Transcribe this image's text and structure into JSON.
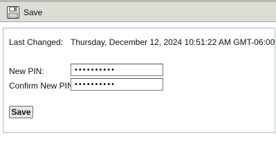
{
  "toolbar": {
    "save_label": "Save",
    "save_icon": "floppy-disk-icon"
  },
  "form": {
    "last_changed_label": "Last Changed:",
    "last_changed_value": "Thursday, December 12, 2024 10:51:22 AM GMT-06:00",
    "new_pin_label": "New PIN:",
    "new_pin_value": "0000000000",
    "confirm_pin_label": "Confirm New PIN:",
    "confirm_pin_value": "0000000000",
    "save_button_label": "Save"
  }
}
